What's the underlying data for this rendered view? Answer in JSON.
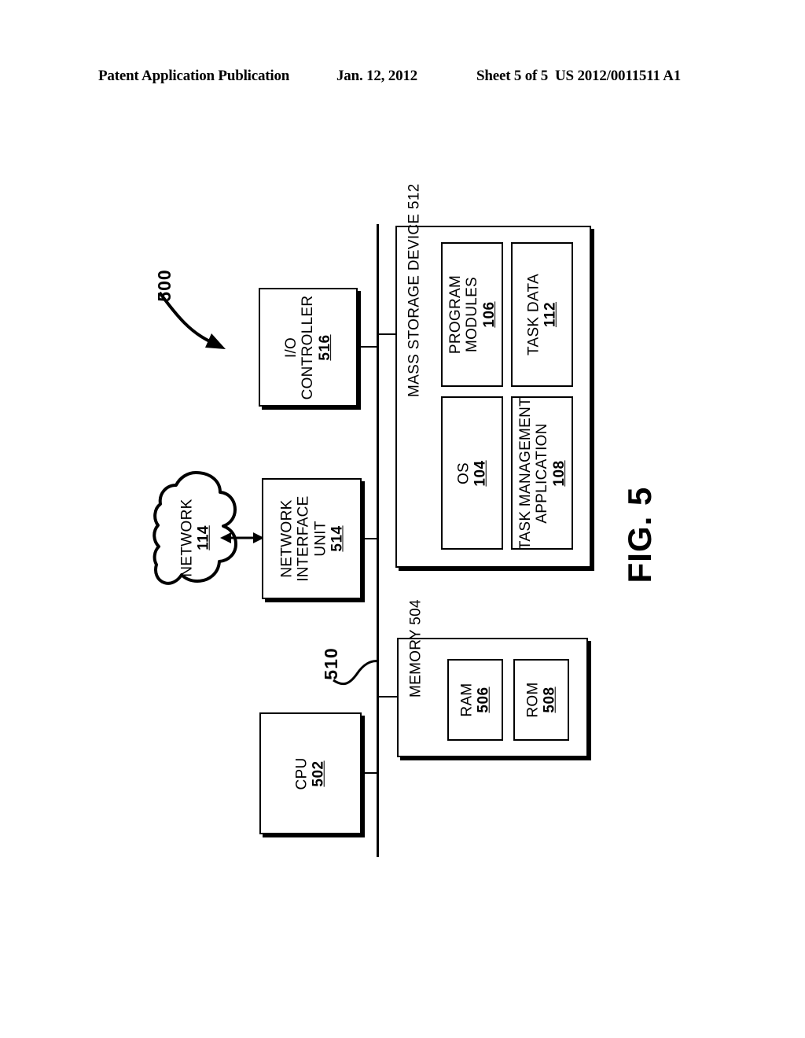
{
  "header": {
    "publication": "Patent Application Publication",
    "date": "Jan. 12, 2012",
    "sheet": "Sheet 5 of 5",
    "patent_number": "US 2012/0011511 A1"
  },
  "figure": {
    "caption": "FIG. 5",
    "system_ref": "500",
    "bus_ref": "510"
  },
  "blocks": {
    "io_controller": {
      "line1": "I/O",
      "line2": "CONTROLLER",
      "ref": "516"
    },
    "network_interface": {
      "line1": "NETWORK",
      "line2": "INTERFACE",
      "line3": "UNIT",
      "ref": "514"
    },
    "cpu": {
      "line1": "CPU",
      "ref": "502"
    },
    "network_cloud": {
      "line1": "NETWORK",
      "ref": "114"
    },
    "mass_storage": {
      "line1": "MASS STORAGE DEVICE",
      "ref": "512"
    },
    "memory": {
      "line1": "MEMORY",
      "ref": "504"
    },
    "ram": {
      "line1": "RAM",
      "ref": "506"
    },
    "rom": {
      "line1": "ROM",
      "ref": "508"
    },
    "program_modules": {
      "line1": "PROGRAM",
      "line2": "MODULES",
      "ref": "106"
    },
    "task_data": {
      "line1": "TASK DATA",
      "ref": "112"
    },
    "os": {
      "line1": "OS",
      "ref": "104"
    },
    "task_management_application": {
      "line1": "TASK MANAGEMENT",
      "line2": "APPLICATION",
      "ref": "108"
    }
  },
  "colors": {
    "stroke": "#000000",
    "background": "#ffffff"
  }
}
